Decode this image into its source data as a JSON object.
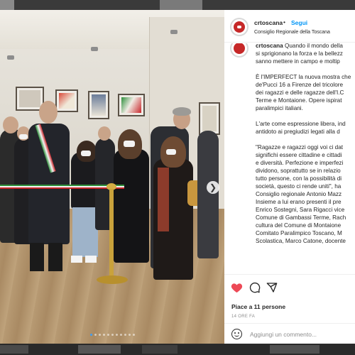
{
  "post": {
    "username": "crtoscana",
    "separator": "•",
    "follow_label": "Segui",
    "location": "Consiglio Regionale della Toscana"
  },
  "caption": {
    "lines": [
      "crtoscana Quando il mondo della",
      "si sprigionano la forza e la bellezz",
      "sanno mettere in campo e moltip",
      "",
      "È l'IMPERFECT la nuova mostra che",
      "de'Pucci 16 a Firenze del tricolore",
      "dei ragazzi e delle ragazze dell'I.C",
      "Terme e Montaione. Opere ispirat",
      "paralimpici italiani.",
      "",
      "L'arte come espressione libera, ind",
      "antidoto ai pregiudizi legati alla d",
      "",
      "\"Ragazze e ragazzi oggi voi ci dat",
      "significhi essere cittadine e cittadi",
      "e diversità. Perfezione e imperfezi",
      "dividono, soprattutto se in relazio",
      "tutto persone, con la possibilità di",
      "società, questo ci rende uniti\", ha",
      "Consiglio regionale Antonio Mazz",
      "Insieme a lui erano presenti il pre",
      "Enrico Sostegni, Sara Rigacci vice",
      "Comune di Gambassi Terme, Rach",
      "cultura del Comune di Montaione",
      "Comitato Paralimpico Toscano, M",
      "Scolastica, Marco Catone, docente"
    ]
  },
  "actions": {
    "like_icon": "heart-icon",
    "comment_icon": "comment-icon",
    "share_icon": "share-icon",
    "like_color": "#ed4956"
  },
  "likes_label": "Piace a 11 persone",
  "time_label": "14 ORE FA",
  "comment": {
    "placeholder": "Aggiungi un commento..."
  },
  "carousel": {
    "dot_count": 11,
    "active_index": 0,
    "next_icon": "chevron-right-icon"
  },
  "colors": {
    "accent": "#0095f6",
    "brand_red": "#c62828"
  }
}
